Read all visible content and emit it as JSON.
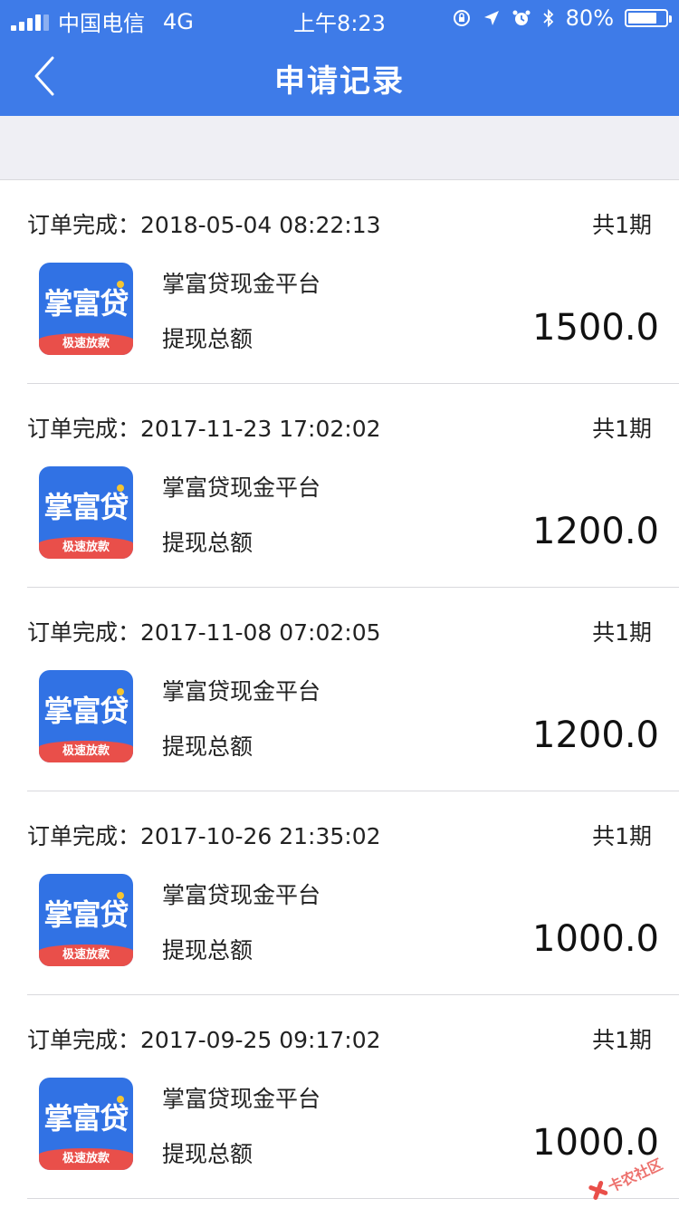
{
  "status_bar": {
    "carrier": "中国电信",
    "network": "4G",
    "time": "上午8:23",
    "battery_text": "80%",
    "battery_level": 0.8,
    "icons": [
      "rotation-lock-icon",
      "location-icon",
      "alarm-icon",
      "bluetooth-icon",
      "battery-icon"
    ]
  },
  "nav": {
    "title": "申请记录",
    "back_icon": "chevron-left-icon"
  },
  "colors": {
    "header_bg": "#3e7be8",
    "page_band": "#efeff4",
    "logo_blue": "#3172e4",
    "logo_red": "#e94f4a"
  },
  "logo": {
    "name": "掌富贷",
    "tagline": "极速放款"
  },
  "records": [
    {
      "status": "订单完成：",
      "datetime": "2018-05-04 08:22:13",
      "periods": "共1期",
      "platform": "掌富贷现金平台",
      "total_label": "提现总额",
      "amount": "1500.0"
    },
    {
      "status": "订单完成：",
      "datetime": "2017-11-23 17:02:02",
      "periods": "共1期",
      "platform": "掌富贷现金平台",
      "total_label": "提现总额",
      "amount": "1200.0"
    },
    {
      "status": "订单完成：",
      "datetime": "2017-11-08 07:02:05",
      "periods": "共1期",
      "platform": "掌富贷现金平台",
      "total_label": "提现总额",
      "amount": "1200.0"
    },
    {
      "status": "订单完成：",
      "datetime": "2017-10-26 21:35:02",
      "periods": "共1期",
      "platform": "掌富贷现金平台",
      "total_label": "提现总额",
      "amount": "1000.0"
    },
    {
      "status": "订单完成：",
      "datetime": "2017-09-25 09:17:02",
      "periods": "共1期",
      "platform": "掌富贷现金平台",
      "total_label": "提现总额",
      "amount": "1000.0"
    }
  ],
  "watermark": "卡农社区"
}
